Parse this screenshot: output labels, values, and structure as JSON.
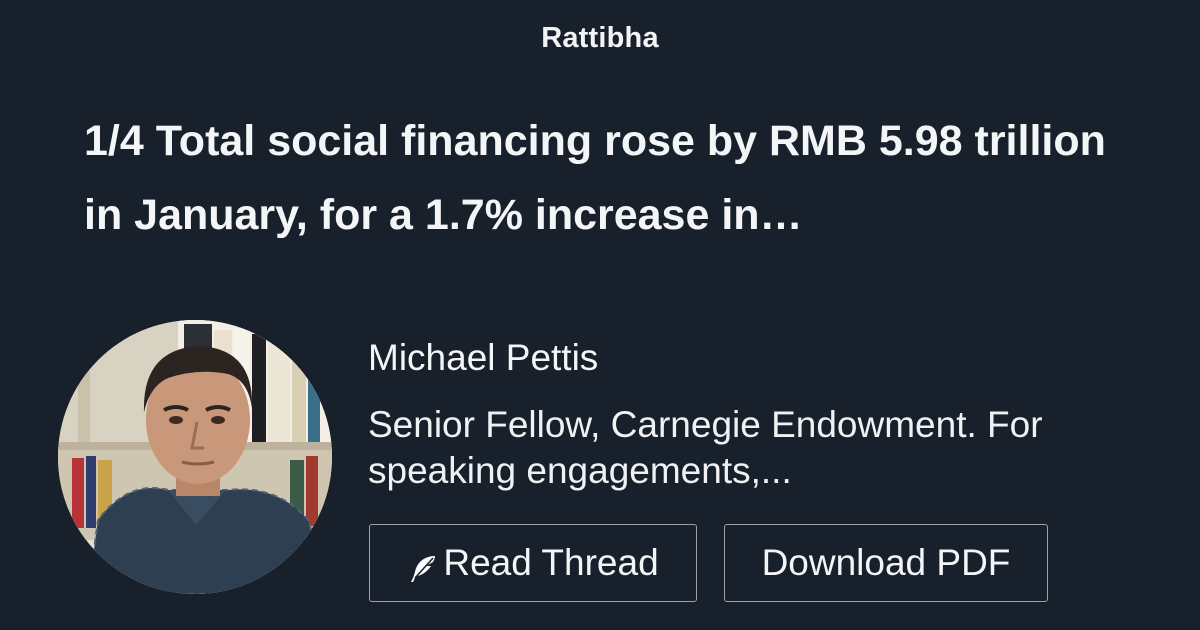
{
  "brand": {
    "name": "Rattibha"
  },
  "thread": {
    "title": "1/4 Total social financing rose by RMB 5.98 trillion in January, for a 1.7% increase in…"
  },
  "author": {
    "name": "Michael Pettis",
    "bio": "Senior Fellow, Carnegie Endowment. For speaking engagements,...",
    "avatar_icon": "author-portrait"
  },
  "actions": {
    "read_label": "Read Thread",
    "read_icon": "feather-icon",
    "download_label": "Download PDF"
  },
  "colors": {
    "background": "#18202b",
    "text": "#f4f5f7",
    "button_border": "#9aa1ab"
  }
}
